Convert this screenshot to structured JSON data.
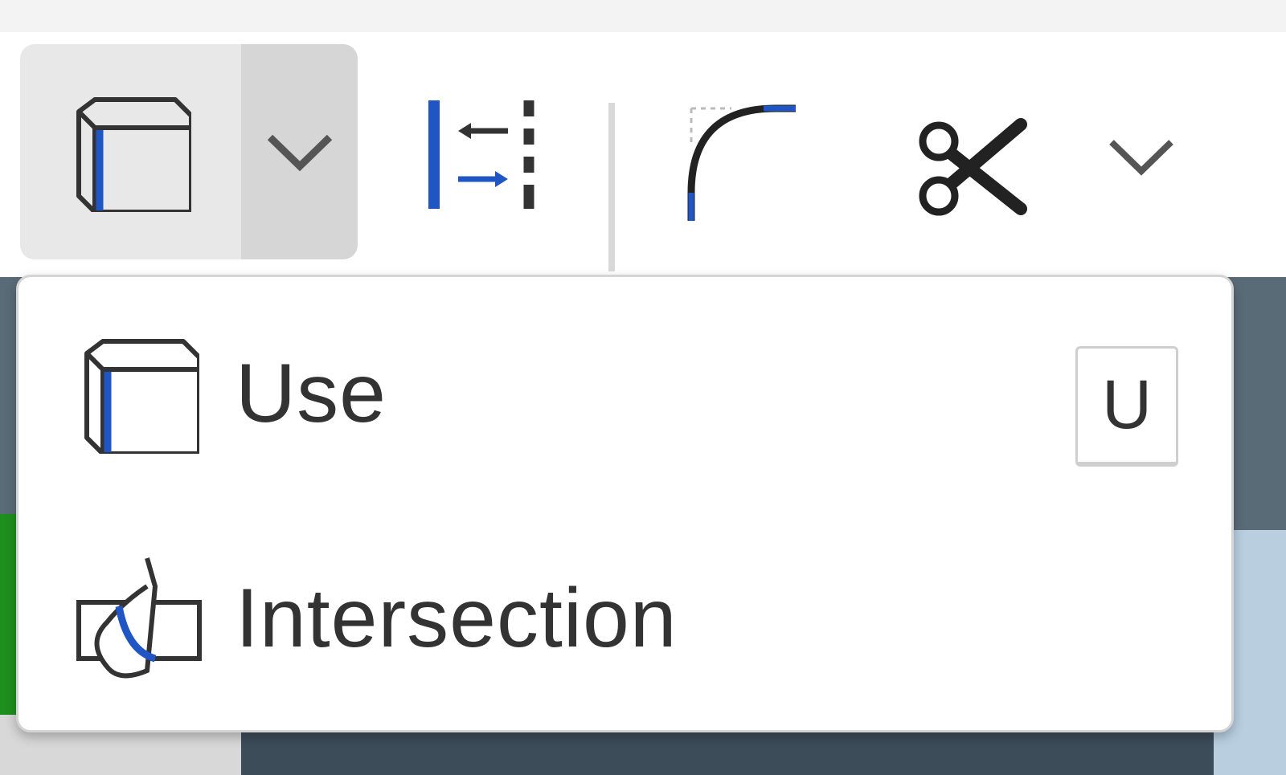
{
  "toolbar": {
    "use_button_icon": "use-cube-icon",
    "dropdown_icon": "chevron-down-icon",
    "tools": [
      {
        "name": "offset-tool",
        "icon": "offset-icon"
      },
      {
        "name": "fillet-tool",
        "icon": "fillet-icon"
      },
      {
        "name": "trim-tool",
        "icon": "scissors-icon"
      },
      {
        "name": "more-tools",
        "icon": "chevron-down-icon"
      }
    ]
  },
  "menu": {
    "items": [
      {
        "label": "Use",
        "shortcut": "U",
        "icon": "use-cube-icon"
      },
      {
        "label": "Intersection",
        "shortcut": "",
        "icon": "intersection-icon"
      }
    ]
  },
  "colors": {
    "accent": "#1f56c4",
    "icon_stroke": "#333333",
    "menu_border": "#d4d4d4",
    "button_bg": "#e8e8e8",
    "button_arrow_bg": "#d6d6d6"
  }
}
